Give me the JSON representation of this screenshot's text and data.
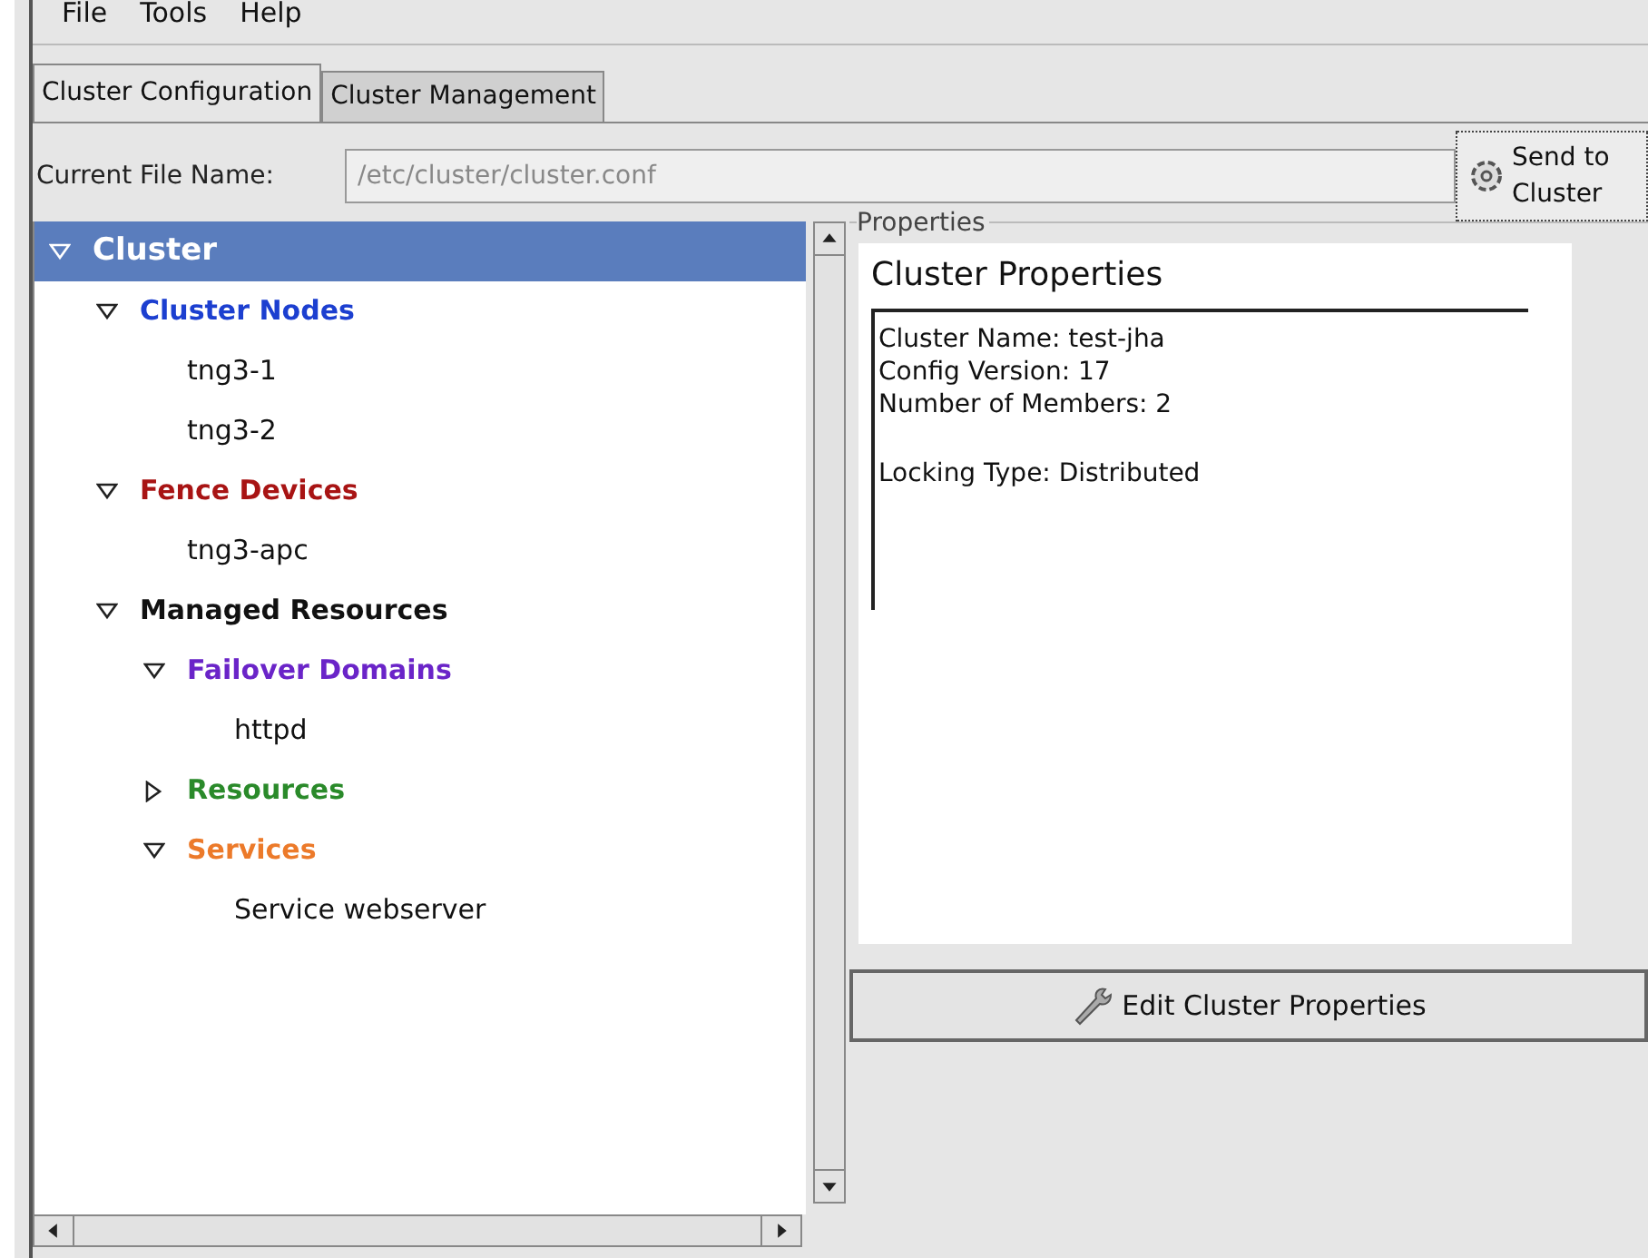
{
  "menu": [
    "File",
    "Tools",
    "Help"
  ],
  "tabs": [
    {
      "label": "Cluster Configuration",
      "selected": true
    },
    {
      "label": "Cluster Management",
      "selected": false
    }
  ],
  "file_name": {
    "label": "Current File Name:",
    "placeholder": "/etc/cluster/cluster.conf"
  },
  "send_button": {
    "label": [
      "Send to",
      "Cluster"
    ]
  },
  "tree": [
    {
      "label": "Cluster",
      "selected": true,
      "expanded": true,
      "children": [
        {
          "label": "Cluster Nodes",
          "color": "#1c3fd0",
          "selected": false,
          "expanded": true,
          "children": [
            {
              "label": "tng3-1",
              "selected": false
            },
            {
              "label": "tng3-2",
              "selected": false
            }
          ]
        },
        {
          "label": "Fence Devices",
          "color": "#a81414",
          "selected": false,
          "expanded": true,
          "children": [
            {
              "label": "tng3-apc",
              "selected": false
            }
          ]
        },
        {
          "label": "Managed Resources",
          "color": "#111111",
          "selected": false,
          "expanded": true,
          "children": [
            {
              "label": "Failover Domains",
              "color": "#6a24c8",
              "selected": false,
              "expanded": true,
              "children": [
                {
                  "label": "httpd",
                  "selected": false
                }
              ]
            },
            {
              "label": "Resources",
              "color": "#2a8a2a",
              "selected": false,
              "expanded": false
            },
            {
              "label": "Services",
              "color": "#ec7a2a",
              "selected": false,
              "expanded": true,
              "children": [
                {
                  "label": "Service webserver",
                  "selected": false
                }
              ]
            }
          ]
        }
      ]
    }
  ],
  "properties": {
    "frame_label": "Properties",
    "title": "Cluster Properties",
    "paragraphs": [
      [
        "Cluster Name: test-jha",
        "Config Version: 17",
        "Number of Members: 2"
      ],
      [
        "Locking Type: Distributed"
      ]
    ]
  },
  "edit_button": {
    "label": "Edit Cluster Properties"
  }
}
